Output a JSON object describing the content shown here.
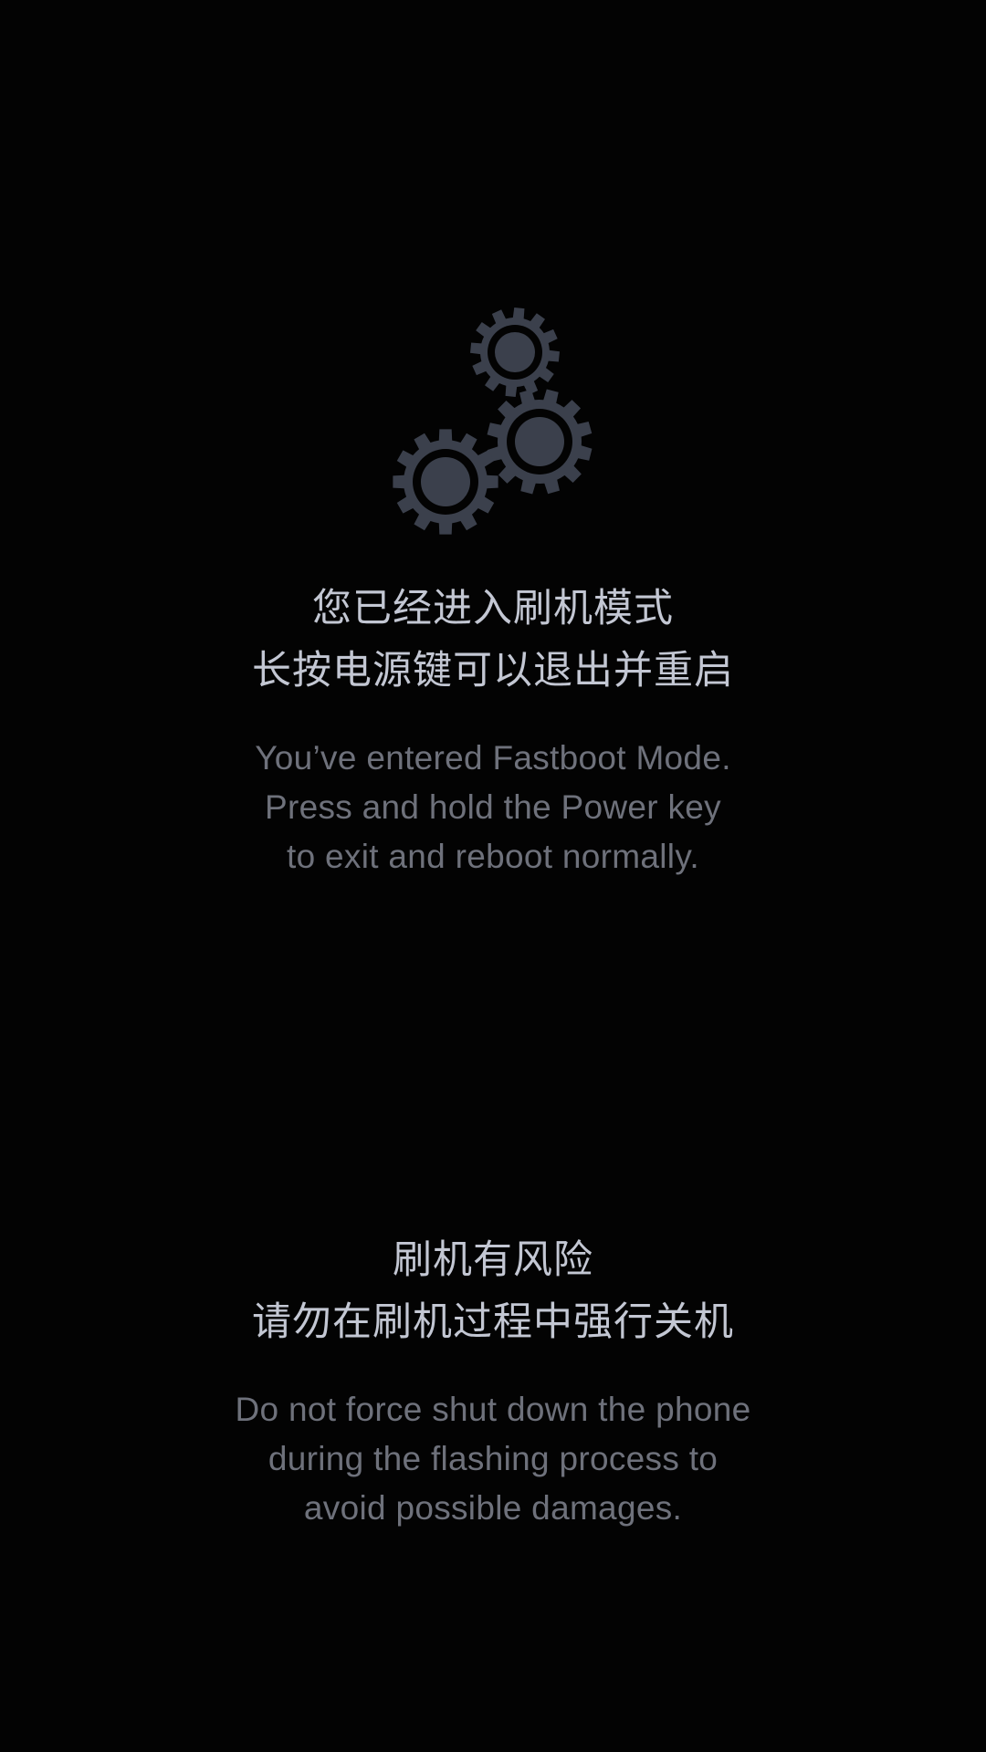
{
  "icon": {
    "name": "gears-icon",
    "color": "#3b404c",
    "hub_color": "#030303"
  },
  "fastboot_notice": {
    "zh_lines": [
      "您已经进入刷机模式",
      "长按电源键可以退出并重启"
    ],
    "en_lines": [
      "You’ve entered Fastboot Mode.",
      "Press and hold the Power key",
      "to exit and reboot normally."
    ]
  },
  "risk_warning": {
    "zh_lines": [
      "刷机有风险",
      "请勿在刷机过程中强行关机"
    ],
    "en_lines": [
      "Do not force shut down the phone",
      "during the flashing process to",
      "avoid possible damages."
    ]
  },
  "colors": {
    "background": "#030303",
    "zh_text": "#c3c7d3",
    "en_text": "#6e717b"
  }
}
